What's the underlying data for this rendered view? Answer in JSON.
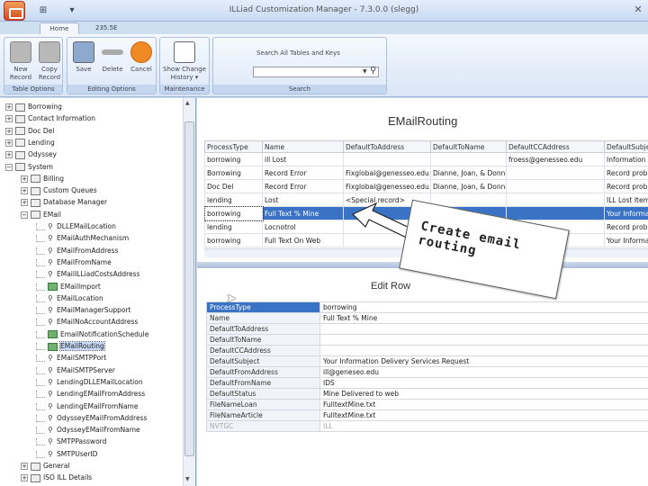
{
  "window": {
    "title": "ILLiad Customization Manager - 7.3.0.0 (slegg)",
    "close_glyph": "✕"
  },
  "quick_access": {
    "items": [
      "⊞",
      "▾"
    ]
  },
  "ribbon": {
    "tabs": [
      "Home",
      "235.5E"
    ],
    "groups": [
      {
        "label": "Table Options",
        "buttons": [
          {
            "label": "New Record",
            "icon": "new-record-icon"
          },
          {
            "label": "Copy Record",
            "icon": "copy-record-icon"
          }
        ]
      },
      {
        "label": "Editing Options",
        "buttons": [
          {
            "label": "Save",
            "icon": "save-icon"
          },
          {
            "label": "Delete",
            "icon": "delete-icon"
          },
          {
            "label": "Cancel",
            "icon": "cancel-icon"
          }
        ]
      },
      {
        "label": "Maintenance",
        "buttons": [
          {
            "label": "Show Change History ▾",
            "icon": "history-icon"
          }
        ]
      },
      {
        "label": "Search",
        "search_label": "Search All Tables and Keys",
        "search_value": ""
      }
    ]
  },
  "tree": {
    "items": [
      {
        "label": "Borrowing",
        "level": 0,
        "expander": "+",
        "kind": "folder"
      },
      {
        "label": "Contact Information",
        "level": 0,
        "expander": "+",
        "kind": "folder"
      },
      {
        "label": "Doc Del",
        "level": 0,
        "expander": "+",
        "kind": "folder"
      },
      {
        "label": "Lending",
        "level": 0,
        "expander": "+",
        "kind": "folder"
      },
      {
        "label": "Odyssey",
        "level": 0,
        "expander": "+",
        "kind": "folder"
      },
      {
        "label": "System",
        "level": 0,
        "expander": "−",
        "kind": "folder"
      },
      {
        "label": "Billing",
        "level": 1,
        "expander": "+",
        "kind": "folder"
      },
      {
        "label": "Custom Queues",
        "level": 1,
        "expander": "+",
        "kind": "folder"
      },
      {
        "label": "Database Manager",
        "level": 1,
        "expander": "+",
        "kind": "folder"
      },
      {
        "label": "EMail",
        "level": 1,
        "expander": "−",
        "kind": "folder"
      },
      {
        "label": "DLLEMailLocation",
        "level": 2,
        "kind": "key"
      },
      {
        "label": "EMailAuthMechanism",
        "level": 2,
        "kind": "key"
      },
      {
        "label": "EMailFromAddress",
        "level": 2,
        "kind": "key"
      },
      {
        "label": "EMailFromName",
        "level": 2,
        "kind": "key"
      },
      {
        "label": "EMailILLiadCostsAddress",
        "level": 2,
        "kind": "key"
      },
      {
        "label": "EMailImport",
        "level": 2,
        "kind": "table"
      },
      {
        "label": "EMailLocation",
        "level": 2,
        "kind": "key"
      },
      {
        "label": "EMailManagerSupport",
        "level": 2,
        "kind": "key"
      },
      {
        "label": "EMailNoAccountAddress",
        "level": 2,
        "kind": "key"
      },
      {
        "label": "EmailNotificationSchedule",
        "level": 2,
        "kind": "table"
      },
      {
        "label": "EMailRouting",
        "level": 2,
        "kind": "table",
        "selected": true
      },
      {
        "label": "EMailSMTPPort",
        "level": 2,
        "kind": "key"
      },
      {
        "label": "EMailSMTPServer",
        "level": 2,
        "kind": "key"
      },
      {
        "label": "LendingDLLEMailLocation",
        "level": 2,
        "kind": "key"
      },
      {
        "label": "LendingEMailFromAddress",
        "level": 2,
        "kind": "key"
      },
      {
        "label": "LendingEMailFromName",
        "level": 2,
        "kind": "key"
      },
      {
        "label": "OdysseyEMailFromAddress",
        "level": 2,
        "kind": "key"
      },
      {
        "label": "OdysseyEMailFromName",
        "level": 2,
        "kind": "key"
      },
      {
        "label": "SMTPPassword",
        "level": 2,
        "kind": "key"
      },
      {
        "label": "SMTPUserID",
        "level": 2,
        "kind": "key"
      },
      {
        "label": "General",
        "level": 1,
        "expander": "+",
        "kind": "folder"
      },
      {
        "label": "ISO ILL Details",
        "level": 1,
        "expander": "+",
        "kind": "folder"
      }
    ]
  },
  "routing": {
    "title": "EMailRouting",
    "columns": [
      "ProcessType",
      "Name",
      "DefaultToAddress",
      "DefaultToName",
      "DefaultCCAddress",
      "DefaultSubject"
    ],
    "rows": [
      [
        "borrowing",
        "ill Lost",
        "",
        "",
        "froess@genesseo.edu",
        "Information f"
      ],
      [
        "Borrowing",
        "Record Error",
        "Fixglobal@genesseo.edu",
        "Dianne, Joan, & Donna",
        "",
        "Record probl"
      ],
      [
        "Doc Del",
        "Record Error",
        "Fixglobal@genesseo.edu",
        "Dianne, Joan, & Donna",
        "",
        "Record probl"
      ],
      [
        "lending",
        "Lost",
        "<Special record>",
        "",
        "",
        "ILL Lost Item"
      ],
      [
        "borrowing",
        "Full Text % Mine",
        "",
        "",
        "",
        "Your Informa"
      ],
      [
        "lending",
        "Locnotrol",
        "",
        "",
        "",
        "Record probl"
      ],
      [
        "borrowing",
        "Full Text On Web",
        "",
        "",
        "",
        "Your Informa"
      ]
    ],
    "selected_row": 4
  },
  "edit_row": {
    "title": "Edit Row",
    "fields": [
      {
        "key": "ProcessType",
        "value": "borrowing",
        "highlight": true
      },
      {
        "key": "Name",
        "value": "Full Text % Mine"
      },
      {
        "key": "DefaultToAddress",
        "value": ""
      },
      {
        "key": "DefaultToName",
        "value": ""
      },
      {
        "key": "DefaultCCAddress",
        "value": ""
      },
      {
        "key": "DefaultSubject",
        "value": "Your Information Delivery Services Request"
      },
      {
        "key": "DefaultFromAddress",
        "value": "ill@geneseo.edu"
      },
      {
        "key": "DefaultFromName",
        "value": "IDS"
      },
      {
        "key": "DefaultStatus",
        "value": "Mine Delivered to web"
      },
      {
        "key": "FileNameLoan",
        "value": "FulltextMine.txt"
      },
      {
        "key": "FileNameArticle",
        "value": "FulltextMine.txt"
      },
      {
        "key": "NVTGC",
        "value": "ILL",
        "dim": true
      }
    ]
  },
  "callout": {
    "text": "Create email routing"
  }
}
